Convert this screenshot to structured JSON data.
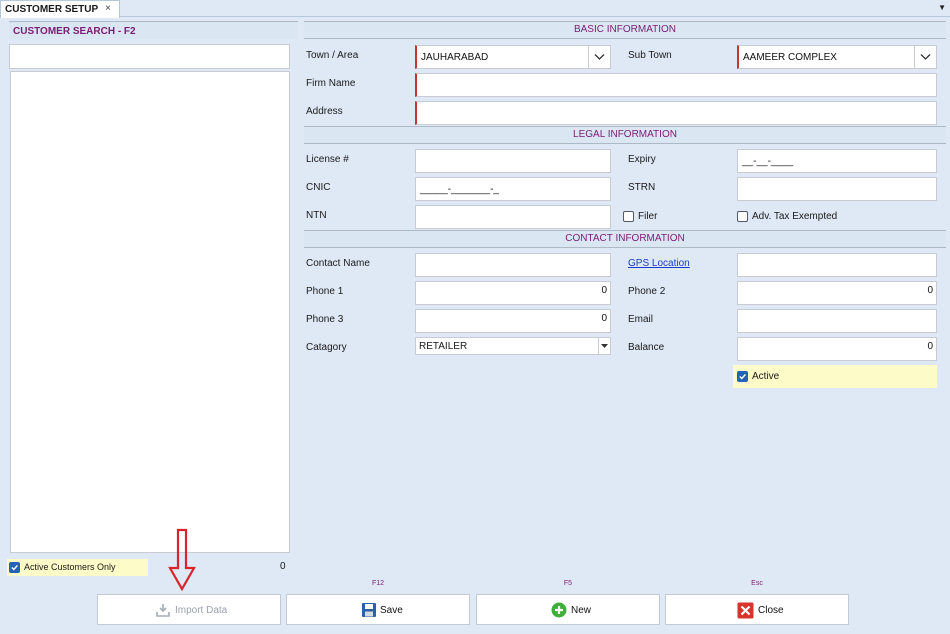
{
  "tab": {
    "title": "CUSTOMER SETUP",
    "close": "×",
    "menu": "▼"
  },
  "search": {
    "title": "CUSTOMER SEARCH - F2",
    "value": "",
    "active_only_label": "Active Customers Only",
    "active_only_checked": true,
    "count": "0"
  },
  "basic": {
    "header": "BASIC INFORMATION",
    "town_label": "Town / Area",
    "town_value": "JAUHARABAD",
    "subtown_label": "Sub Town",
    "subtown_value": "AAMEER COMPLEX",
    "firm_label": "Firm Name",
    "firm_value": "",
    "address_label": "Address",
    "address_value": ""
  },
  "legal": {
    "header": "LEGAL INFORMATION",
    "license_label": "License #",
    "license_value": "",
    "expiry_label": "Expiry",
    "expiry_value": "__-__-____",
    "cnic_label": "CNIC",
    "cnic_value": "_____-_______-_",
    "strn_label": "STRN",
    "strn_value": "",
    "ntn_label": "NTN",
    "ntn_value": "",
    "filer_label": "Filer",
    "filer_checked": false,
    "adv_tax_label": "Adv. Tax Exempted",
    "adv_tax_checked": false
  },
  "contact": {
    "header": "CONTACT INFORMATION",
    "contact_name_label": "Contact Name",
    "contact_name_value": "",
    "gps_label": "GPS Location",
    "gps_value": "",
    "phone1_label": "Phone 1",
    "phone1_value": "0",
    "phone2_label": "Phone 2",
    "phone2_value": "0",
    "phone3_label": "Phone 3",
    "phone3_value": "0",
    "email_label": "Email",
    "email_value": "",
    "category_label": "Catagory",
    "category_value": "RETAILER",
    "balance_label": "Balance",
    "balance_value": "0",
    "active_label": "Active",
    "active_checked": true
  },
  "buttons": {
    "import_label": "Import Data",
    "save_label": "Save",
    "save_hotkey": "F12",
    "new_label": "New",
    "new_hotkey": "F5",
    "close_label": "Close",
    "close_hotkey": "Esc"
  },
  "colors": {
    "accent_purple": "#7a1d73",
    "required_red": "#c0392b",
    "active_yellow": "#fdfbc7",
    "arrow_red": "#d9242b"
  }
}
